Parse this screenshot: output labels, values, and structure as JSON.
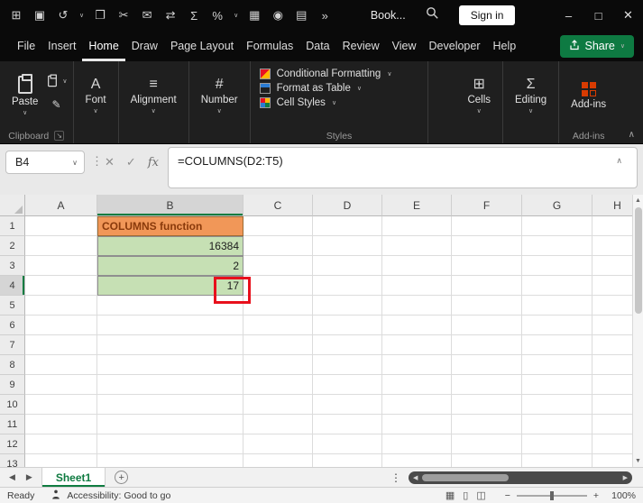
{
  "colors": {
    "accent_green": "#107C41",
    "share_green": "#0E7A42",
    "title_cell_fill": "#F19758",
    "title_cell_text": "#8A3A0B",
    "value_cell_fill": "#C6E0B4",
    "annotation_red": "#E8101C"
  },
  "icons": {
    "app_grid": "⊞",
    "save": "▣",
    "undo": "↺",
    "copy": "❐",
    "cut": "✂",
    "mail": "✉",
    "swap": "⇄",
    "autosum": "Σ",
    "percent": "%",
    "borders": "▦",
    "camera": "◉",
    "table": "▤",
    "overflow": "»",
    "caret_down": "∨",
    "caret_up": "∧",
    "minimize": "–",
    "maximize": "□",
    "close": "✕",
    "dots_v": "⋮",
    "cancel": "✕",
    "check": "✓",
    "fx": "fx",
    "launcher": "↘",
    "prev": "◀",
    "next": "▶",
    "up": "▲",
    "down": "▼",
    "add": "+",
    "minus": "−",
    "plus": "+",
    "view_normal": "▦",
    "view_layout": "▯",
    "view_break": "◫",
    "font_glyph": "A",
    "align_glyph": "≡",
    "number_glyph": "#",
    "cells_glyph": "⊞",
    "editing_glyph": "Σ"
  },
  "titlebar": {
    "workbook_name": "Book...",
    "sign_in": "Sign in"
  },
  "menubar": {
    "items": [
      "File",
      "Insert",
      "Home",
      "Draw",
      "Page Layout",
      "Formulas",
      "Data",
      "Review",
      "View",
      "Developer",
      "Help"
    ],
    "active": "Home",
    "share": "Share"
  },
  "ribbon": {
    "paste": "Paste",
    "clipboard_group": "Clipboard",
    "font": "Font",
    "alignment": "Alignment",
    "number": "Number",
    "styles_items": [
      "Conditional Formatting",
      "Format as Table",
      "Cell Styles"
    ],
    "styles_group": "Styles",
    "cells": "Cells",
    "editing": "Editing",
    "addins": "Add-ins",
    "addins_group": "Add-ins"
  },
  "formula_bar": {
    "name_box": "B4",
    "formula": "=COLUMNS(D2:T5)"
  },
  "grid": {
    "columns": [
      "A",
      "B",
      "C",
      "D",
      "E",
      "F",
      "G",
      "H"
    ],
    "row_count": 13,
    "visible_rows": [
      "1",
      "2",
      "3",
      "4",
      "5",
      "6",
      "7",
      "8",
      "9",
      "10",
      "11",
      "12"
    ],
    "selected": "B4",
    "cells": {
      "B1": {
        "text": "COLUMNS function",
        "style": "title"
      },
      "B2": {
        "text": "16384",
        "style": "value"
      },
      "B3": {
        "text": "2",
        "style": "value"
      },
      "B4": {
        "text": "17",
        "style": "value"
      }
    }
  },
  "sheetbar": {
    "tabs": [
      "Sheet1"
    ],
    "active": "Sheet1"
  },
  "statusbar": {
    "mode": "Ready",
    "accessibility": "Accessibility: Good to go",
    "zoom": "100%"
  }
}
